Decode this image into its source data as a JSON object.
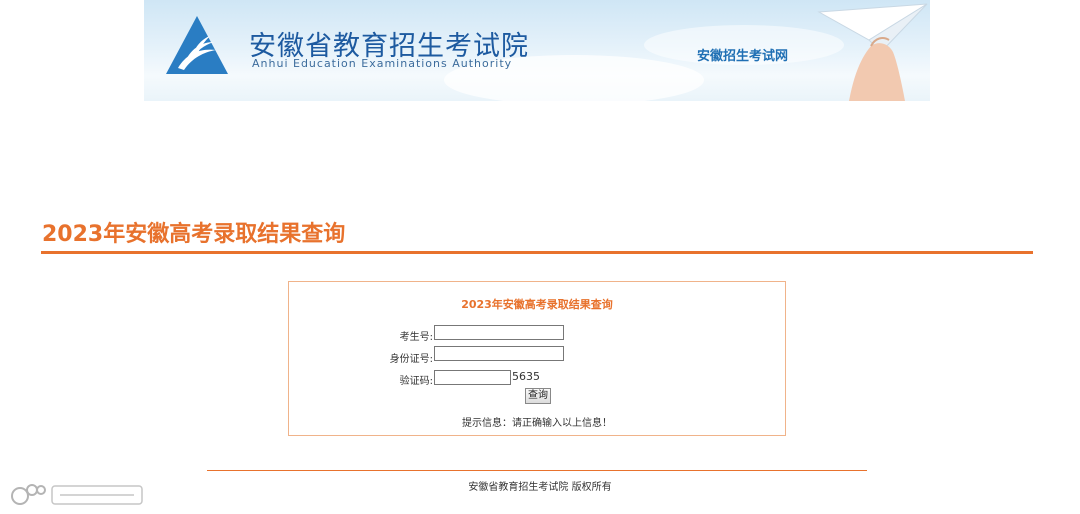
{
  "banner": {
    "org_name_cn": "安徽省教育招生考试院",
    "org_name_en": "Anhui Education Examinations Authority",
    "site_name": "安徽招生考试网"
  },
  "page": {
    "title": "2023年安徽高考录取结果查询"
  },
  "form": {
    "title": "2023年安徽高考录取结果查询",
    "exam_no_label": "考生号:",
    "exam_no_value": "",
    "id_no_label": "身份证号:",
    "id_no_value": "",
    "captcha_label": "验证码:",
    "captcha_value": "",
    "captcha_code": "5635",
    "submit_label": "查询",
    "hint": "提示信息：请正确输入以上信息！"
  },
  "footer": {
    "copyright": "安徽省教育招生考试院 版权所有"
  },
  "colors": {
    "accent": "#e8722d",
    "box_border": "#f0b38a",
    "brand_blue": "#1d5aa0"
  }
}
